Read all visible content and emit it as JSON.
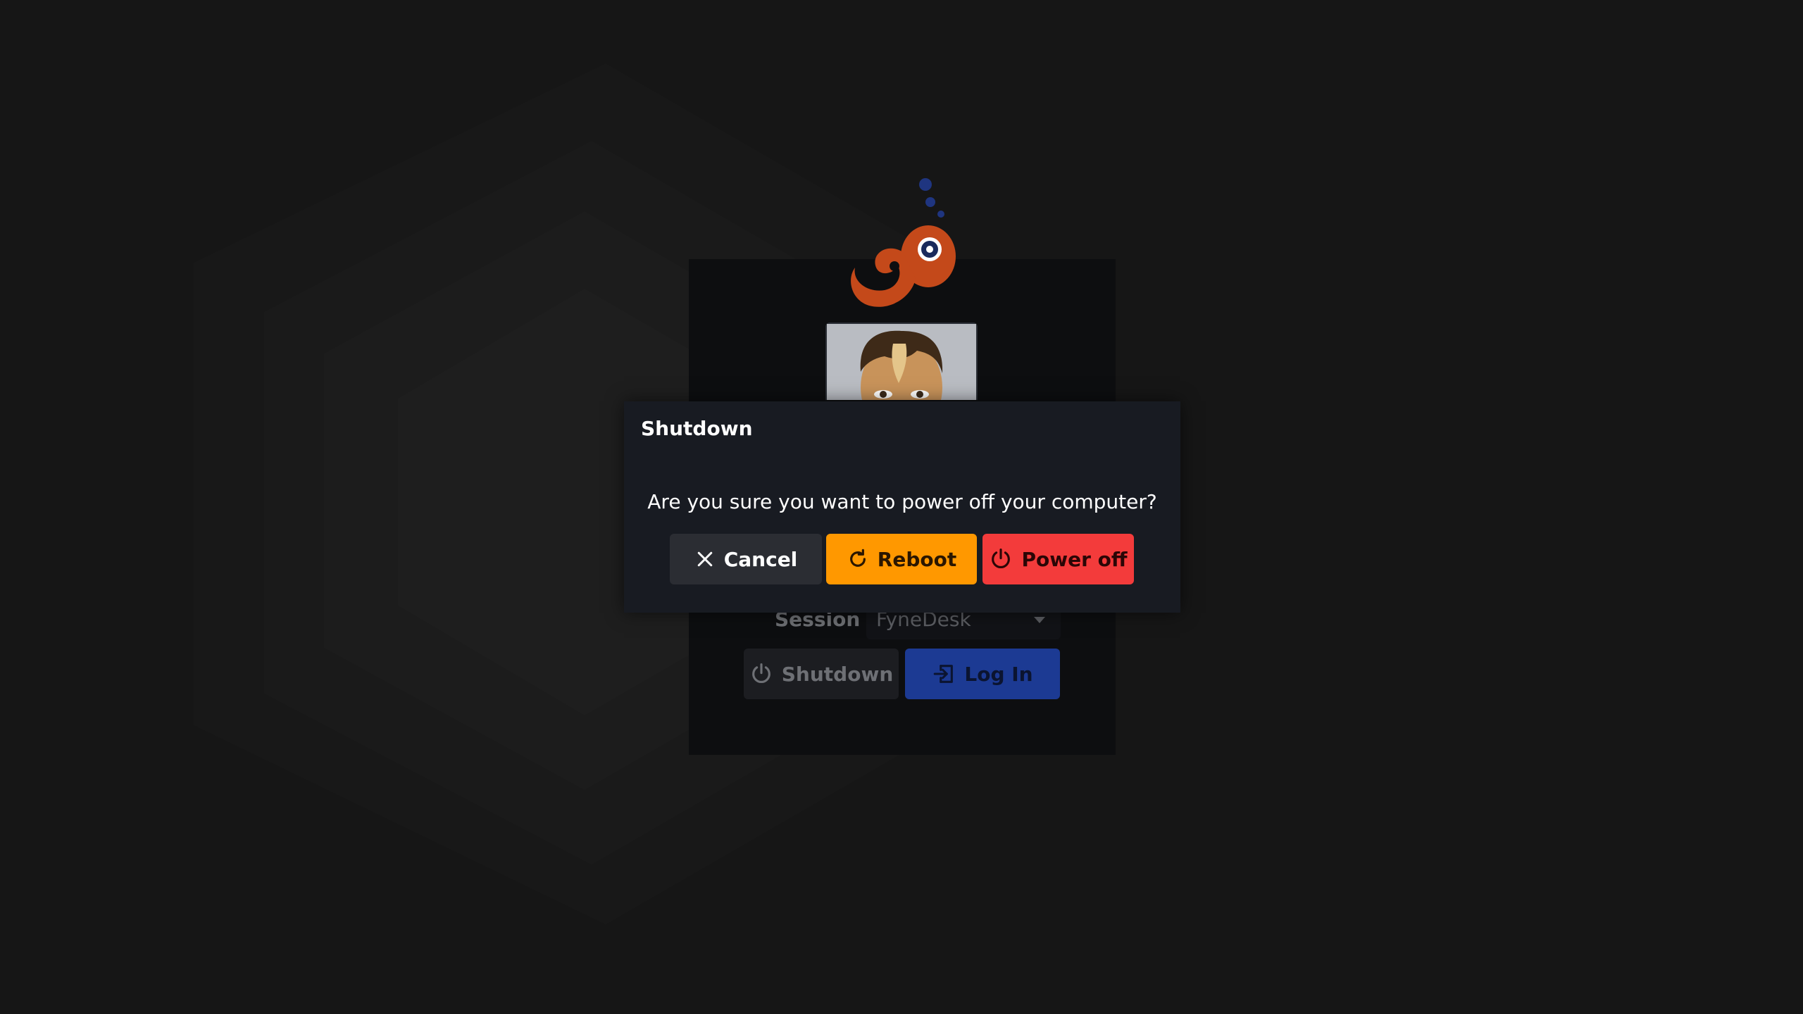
{
  "login": {
    "session_label": "Session",
    "session_value": "FyneDesk",
    "shutdown_label": "Shutdown",
    "login_label": "Log In"
  },
  "dialog": {
    "title": "Shutdown",
    "message": "Are you sure you want to power off your computer?",
    "cancel_label": "Cancel",
    "reboot_label": "Reboot",
    "poweroff_label": "Power off"
  },
  "colors": {
    "background": "#161616",
    "dialog_bg": "#181b22",
    "reboot": "#ff9800",
    "poweroff": "#f33b3b",
    "login": "#1c3a93",
    "logo_fish": "#c4491a",
    "logo_bubbles": "#1f3580"
  },
  "icons": {
    "logo": "fyne-fish-logo",
    "avatar": "user-avatar",
    "session_dropdown": "caret-down-icon",
    "shutdown": "power-icon",
    "login": "login-icon",
    "cancel": "close-icon",
    "reboot": "refresh-icon",
    "poweroff": "power-icon"
  }
}
